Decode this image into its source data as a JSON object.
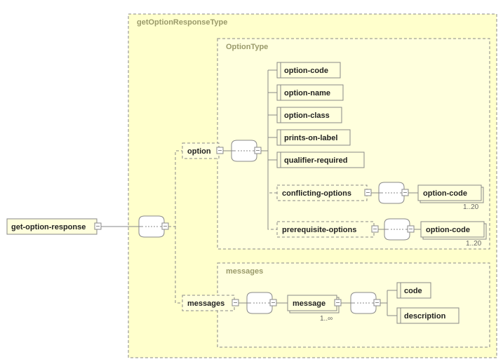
{
  "root": {
    "label": "get-option-response"
  },
  "outerGroup": {
    "label": "getOptionResponseType"
  },
  "optionGroup": {
    "label": "OptionType",
    "anchor": "option",
    "children": {
      "c0": "option-code",
      "c1": "option-name",
      "c2": "option-class",
      "c3": "prints-on-label",
      "c4": "qualifier-required"
    },
    "optA": {
      "label": "conflicting-options",
      "leaf": "option-code",
      "card": "1..20"
    },
    "optB": {
      "label": "prerequisite-options",
      "leaf": "option-code",
      "card": "1..20"
    }
  },
  "messagesGroup": {
    "label": "messages",
    "anchor": "messages",
    "item": {
      "label": "message",
      "card": "1..∞"
    },
    "fields": {
      "f0": "code",
      "f1": "description"
    }
  }
}
